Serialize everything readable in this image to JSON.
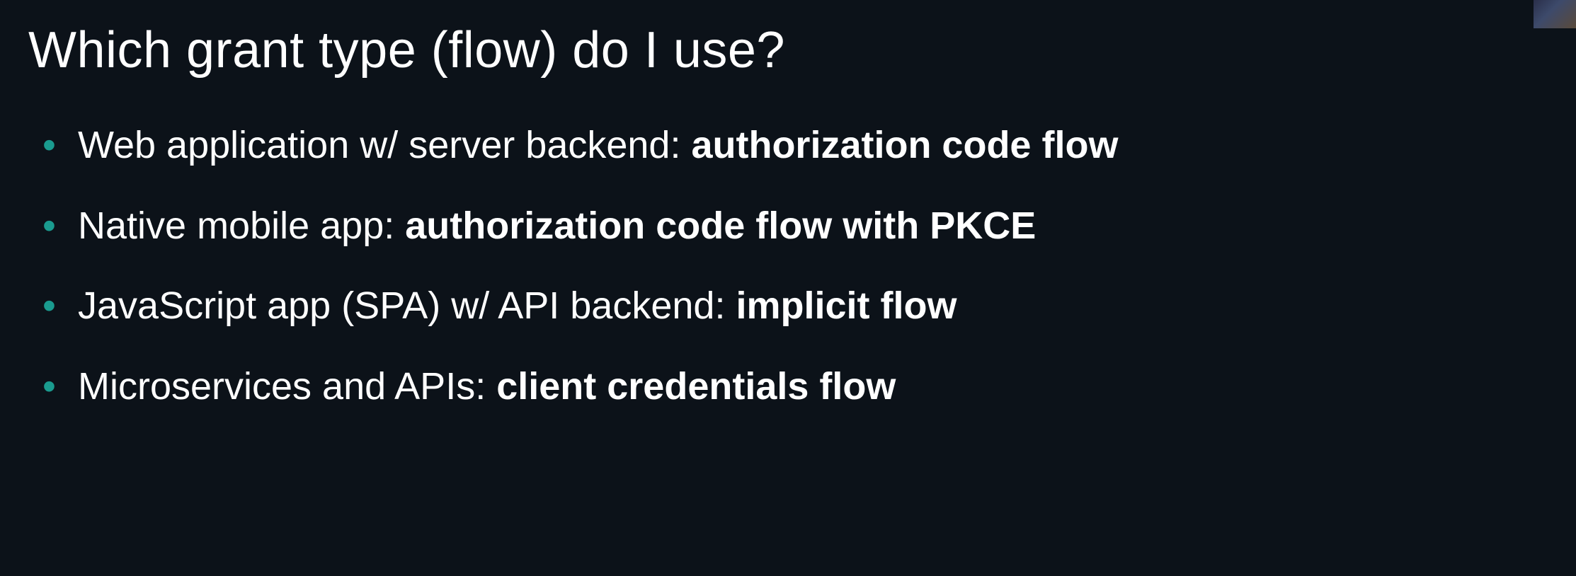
{
  "title": "Which grant type (flow) do I use?",
  "bullet_color": "#1a9b8f",
  "items": [
    {
      "prefix": "Web application w/ server backend: ",
      "bold": "authorization code flow"
    },
    {
      "prefix": "Native mobile app: ",
      "bold": "authorization code flow with PKCE"
    },
    {
      "prefix": "JavaScript app (SPA) w/ API backend: ",
      "bold": "implicit flow"
    },
    {
      "prefix": "Microservices and APIs: ",
      "bold": "client credentials flow"
    }
  ]
}
